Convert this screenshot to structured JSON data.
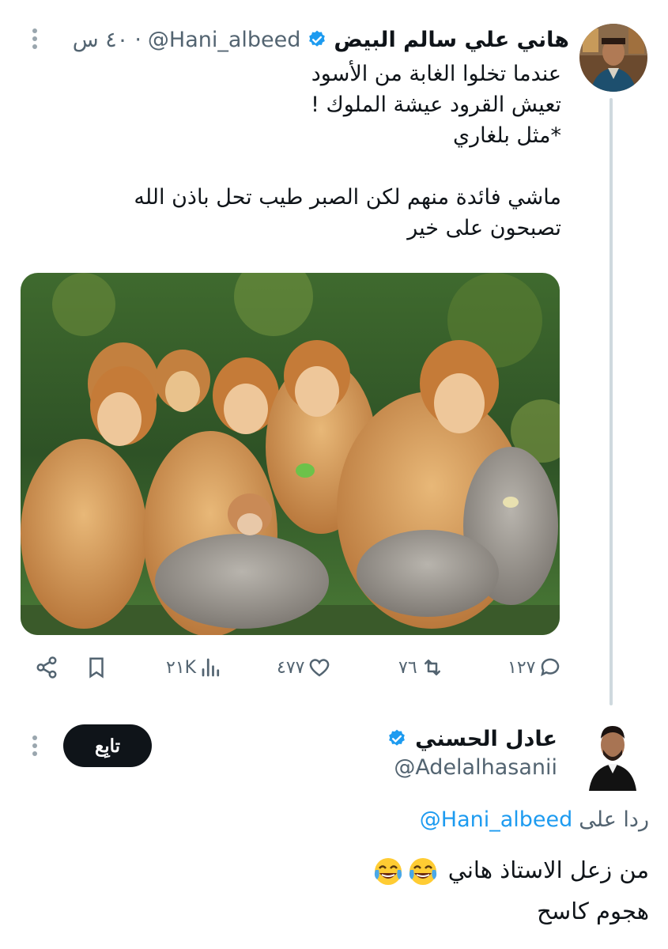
{
  "tweet": {
    "author_name": "هاني علي سالم البيض",
    "author_handle": "@Hani_albeed",
    "separator": "·",
    "time": "٤٠ س",
    "lines": [
      "عندما تخلوا الغابة من الأسود",
      "تعيش القرود عيشة الملوك !",
      "*مثل بلغاري",
      "",
      "ماشي فائدة منهم لكن الصبر طيب تحل باذن الله",
      "تصبحون على خير"
    ],
    "media_icon": "monkeys-photo",
    "stats": {
      "replies": "١٢٧",
      "retweets": "٧٦",
      "likes": "٤٧٧",
      "views": "٢١K"
    }
  },
  "reply": {
    "author_name": "عادل الحسني",
    "author_handle": "@Adelalhasanii",
    "follow_label": "تابِع",
    "replying_prefix": "ردا على",
    "replying_to": "@Hani_albeed",
    "lines": [
      "من زعل الاستاذ هاني",
      "هجوم كاسح"
    ],
    "emoji_icon": "face-with-tears-of-joy"
  },
  "colors": {
    "verified": "#1d9bf0",
    "secondary_text": "#536471",
    "primary_text": "#0f1419",
    "thread_line": "#cfd9de"
  }
}
